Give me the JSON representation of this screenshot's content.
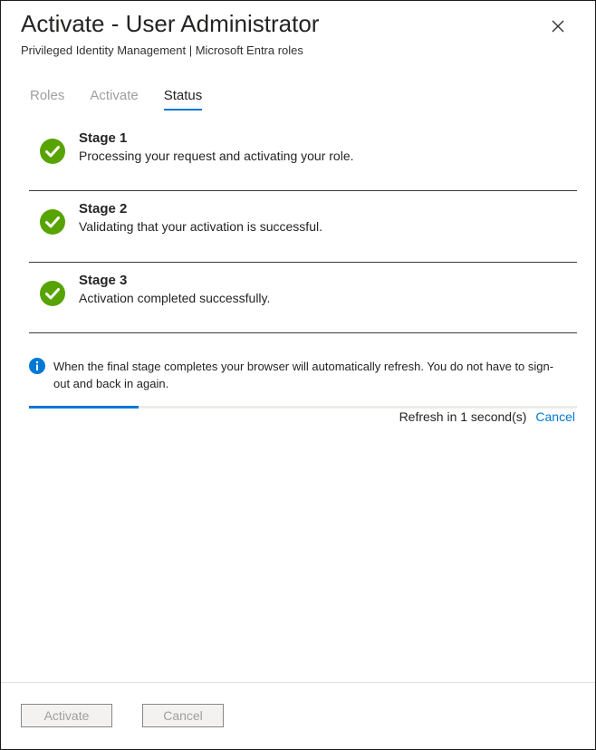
{
  "header": {
    "title": "Activate - User Administrator",
    "subtitle": "Privileged Identity Management | Microsoft Entra roles"
  },
  "tabs": [
    {
      "label": "Roles",
      "active": false
    },
    {
      "label": "Activate",
      "active": false
    },
    {
      "label": "Status",
      "active": true
    }
  ],
  "stages": [
    {
      "name": "Stage 1",
      "description": "Processing your request and activating your role.",
      "status": "complete"
    },
    {
      "name": "Stage 2",
      "description": "Validating that your activation is successful.",
      "status": "complete"
    },
    {
      "name": "Stage 3",
      "description": "Activation completed successfully.",
      "status": "complete"
    }
  ],
  "info": {
    "text": "When the final stage completes your browser will automatically refresh. You do not have to sign-out and back in again."
  },
  "refresh": {
    "progress_percent": 20,
    "text": "Refresh in 1 second(s)",
    "cancel_label": "Cancel"
  },
  "footer": {
    "activate_label": "Activate",
    "cancel_label": "Cancel"
  },
  "colors": {
    "accent": "#0078d4",
    "success": "#57a300"
  }
}
